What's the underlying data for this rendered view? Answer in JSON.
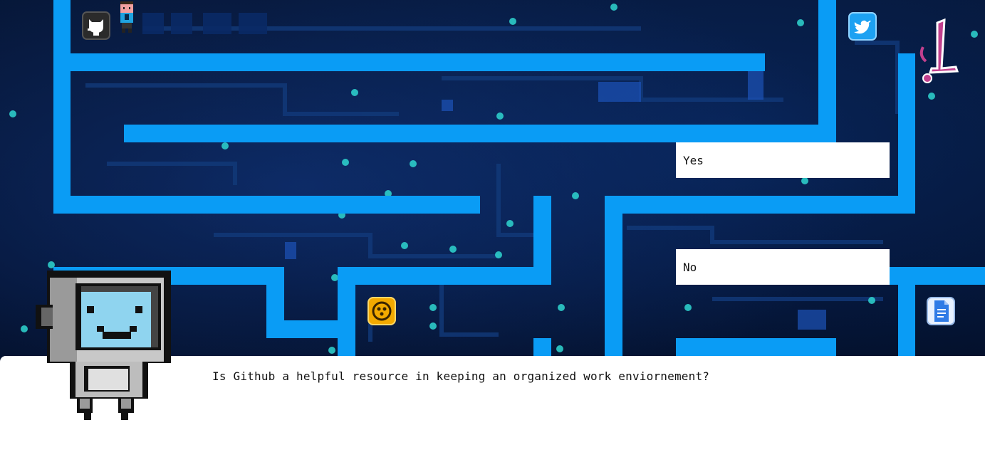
{
  "game": {
    "question": "Is Github a helpful resource in keeping an organized work enviornement?",
    "answers": [
      {
        "label": "Yes"
      },
      {
        "label": "No"
      }
    ]
  },
  "icons": {
    "github": "github-icon",
    "player": "player-sprite-icon",
    "twitter": "twitter-icon",
    "logo": "pink-logo-icon",
    "coin": "gold-coin-icon",
    "document": "google-doc-icon",
    "robot": "robot-guide-icon"
  },
  "colors": {
    "wall": "#0a9cf5",
    "background": "#041024",
    "dialog": "#ffffff"
  }
}
